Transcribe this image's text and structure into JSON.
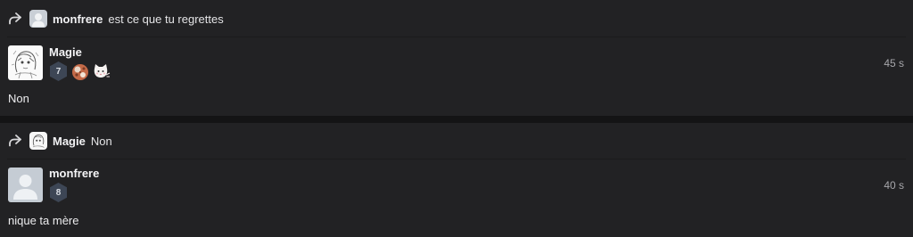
{
  "messages": [
    {
      "reply_to": {
        "user": "monfrere",
        "text": "est ce que tu regrettes",
        "avatar_icon": "default-avatar-icon"
      },
      "author": "Magie",
      "level": "7",
      "badges": [
        "cookie-sticker-icon",
        "cat-sticker-icon"
      ],
      "timestamp": "45 s",
      "text": "Non",
      "avatar_icon": "drawing-avatar-icon"
    },
    {
      "reply_to": {
        "user": "Magie",
        "text": "Non",
        "avatar_icon": "drawing-avatar-icon"
      },
      "author": "monfrere",
      "level": "8",
      "badges": [],
      "timestamp": "40 s",
      "text": "nique ta mère",
      "avatar_icon": "default-avatar-icon"
    }
  ],
  "colors": {
    "background": "#141415",
    "card": "#222224",
    "level_badge": "#3d4655",
    "timestamp": "#a7a7ab"
  }
}
